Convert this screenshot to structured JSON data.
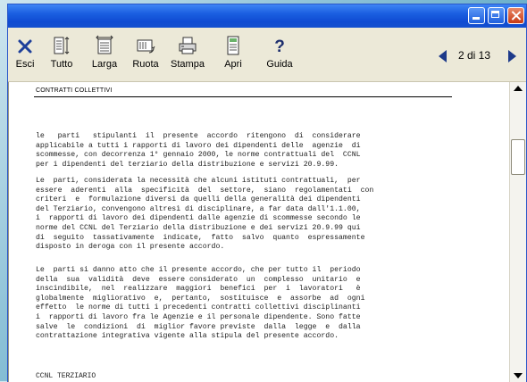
{
  "toolbar": {
    "esci": "Esci",
    "tutto": "Tutto",
    "larga": "Larga",
    "ruota": "Ruota",
    "stampa": "Stampa",
    "apri": "Apri",
    "guida": "Guida"
  },
  "pager": {
    "text": "2 di 13"
  },
  "document": {
    "header": "CONTRATTI COLLETTIVI",
    "paragraph1": "le   parti   stipulanti  il  presente  accordo  ritengono  di  considerare\napplicabile a tutti i rapporti di lavoro dei dipendenti delle  agenzie  di\nscommesse, con decorrenza 1° gennaio 2000, le norme contrattuali del  CCNL\nper i dipendenti del terziario della distribuzione e servizi 20.9.99.",
    "paragraph2": "Le  parti, considerata la necessità che alcuni istituti contrattuali,  per\nessere  aderenti  alla  specificità  del  settore,  siano  regolamentati  con\ncriteri  e  formulazione diversi da quelli della generalità dei dipendenti\ndel Terziario, convengono altresì di disciplinare, a far data dall'1.1.00,\ni  rapporti di lavoro dei dipendenti dalle agenzie di scommesse secondo le\nnorme del CCNL del Terziario della distribuzione e dei servizi 20.9.99 qui\ndi  seguito  tassativamente  indicate,  fatto  salvo  quanto  espressamente\ndisposto in deroga con il presente accordo.",
    "paragraph3": "Le  parti si danno atto che il presente accordo, che per tutto il  periodo\ndella  sua  validità  deve  essere considerato  un  complesso  unitario  e\ninscindibile,  nel  realizzare  maggiori  benefici  per  i  lavoratori   è\nglobalmente  migliorativo  e,  pertanto,  sostituisce  e  assorbe  ad  ogni\neffetto  le norme di tutti i precedenti contratti collettivi disciplinanti\ni  rapporti di lavoro fra le Agenzie e il personale dipendente. Sono fatte\nsalve  le  condizioni  di  miglior favore previste  dalla  legge  e  dalla\ncontrattazione integrativa vigente alla stipula del presente accordo.",
    "footer": "CCNL TERZIARIO"
  }
}
